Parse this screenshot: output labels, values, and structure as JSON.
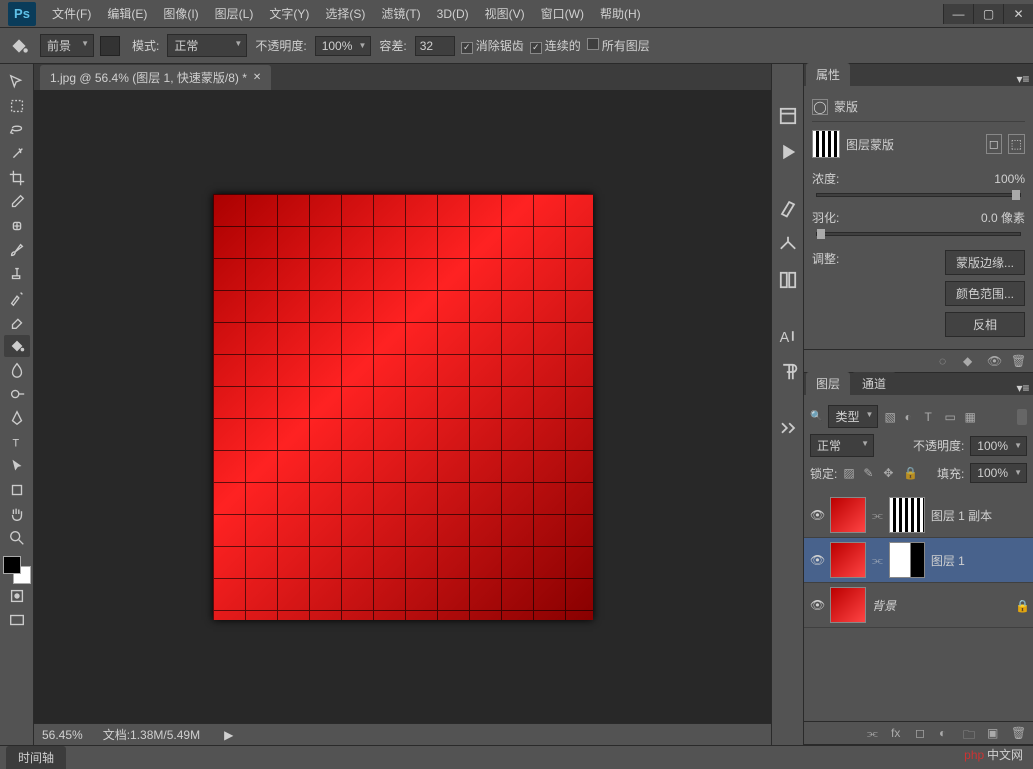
{
  "app": {
    "name": "Ps"
  },
  "menu": [
    "文件(F)",
    "编辑(E)",
    "图像(I)",
    "图层(L)",
    "文字(Y)",
    "选择(S)",
    "滤镜(T)",
    "3D(D)",
    "视图(V)",
    "窗口(W)",
    "帮助(H)"
  ],
  "options": {
    "fill_source": "前景",
    "mode_label": "模式:",
    "mode": "正常",
    "opacity_label": "不透明度:",
    "opacity": "100%",
    "tolerance_label": "容差:",
    "tolerance": "32",
    "antialias": "消除锯齿",
    "contiguous": "连续的",
    "all_layers": "所有图层"
  },
  "document": {
    "tab": "1.jpg @ 56.4% (图层 1, 快速蒙版/8) *",
    "zoom": "56.45%",
    "doc_info": "文档:1.38M/5.49M"
  },
  "bottom_tab": "时间轴",
  "properties": {
    "title": "属性",
    "kind": "蒙版",
    "mask_type": "图层蒙版",
    "density_label": "浓度:",
    "density": "100%",
    "feather_label": "羽化:",
    "feather": "0.0 像素",
    "refine_label": "调整:",
    "btn_edge": "蒙版边缘...",
    "btn_colorrange": "颜色范围...",
    "btn_invert": "反相"
  },
  "layers": {
    "tabs": [
      "图层",
      "通道"
    ],
    "type_label": "类型",
    "blend_mode": "正常",
    "opacity_label": "不透明度:",
    "opacity": "100%",
    "lock_label": "锁定:",
    "fill_label": "填充:",
    "fill": "100%",
    "items": [
      {
        "name": "图层 1 副本",
        "visible": true,
        "mask": "stripes"
      },
      {
        "name": "图层 1",
        "visible": true,
        "mask": "solid",
        "active": true
      },
      {
        "name": "背景",
        "visible": true,
        "locked": true,
        "italic": true
      }
    ]
  },
  "dock_icons": [
    "history-icon",
    "actions-icon",
    "brush-icon",
    "char-icon",
    "swatches-icon",
    "align-icon",
    "para-icon",
    "tool-preset-icon"
  ],
  "watermark": "中文网"
}
